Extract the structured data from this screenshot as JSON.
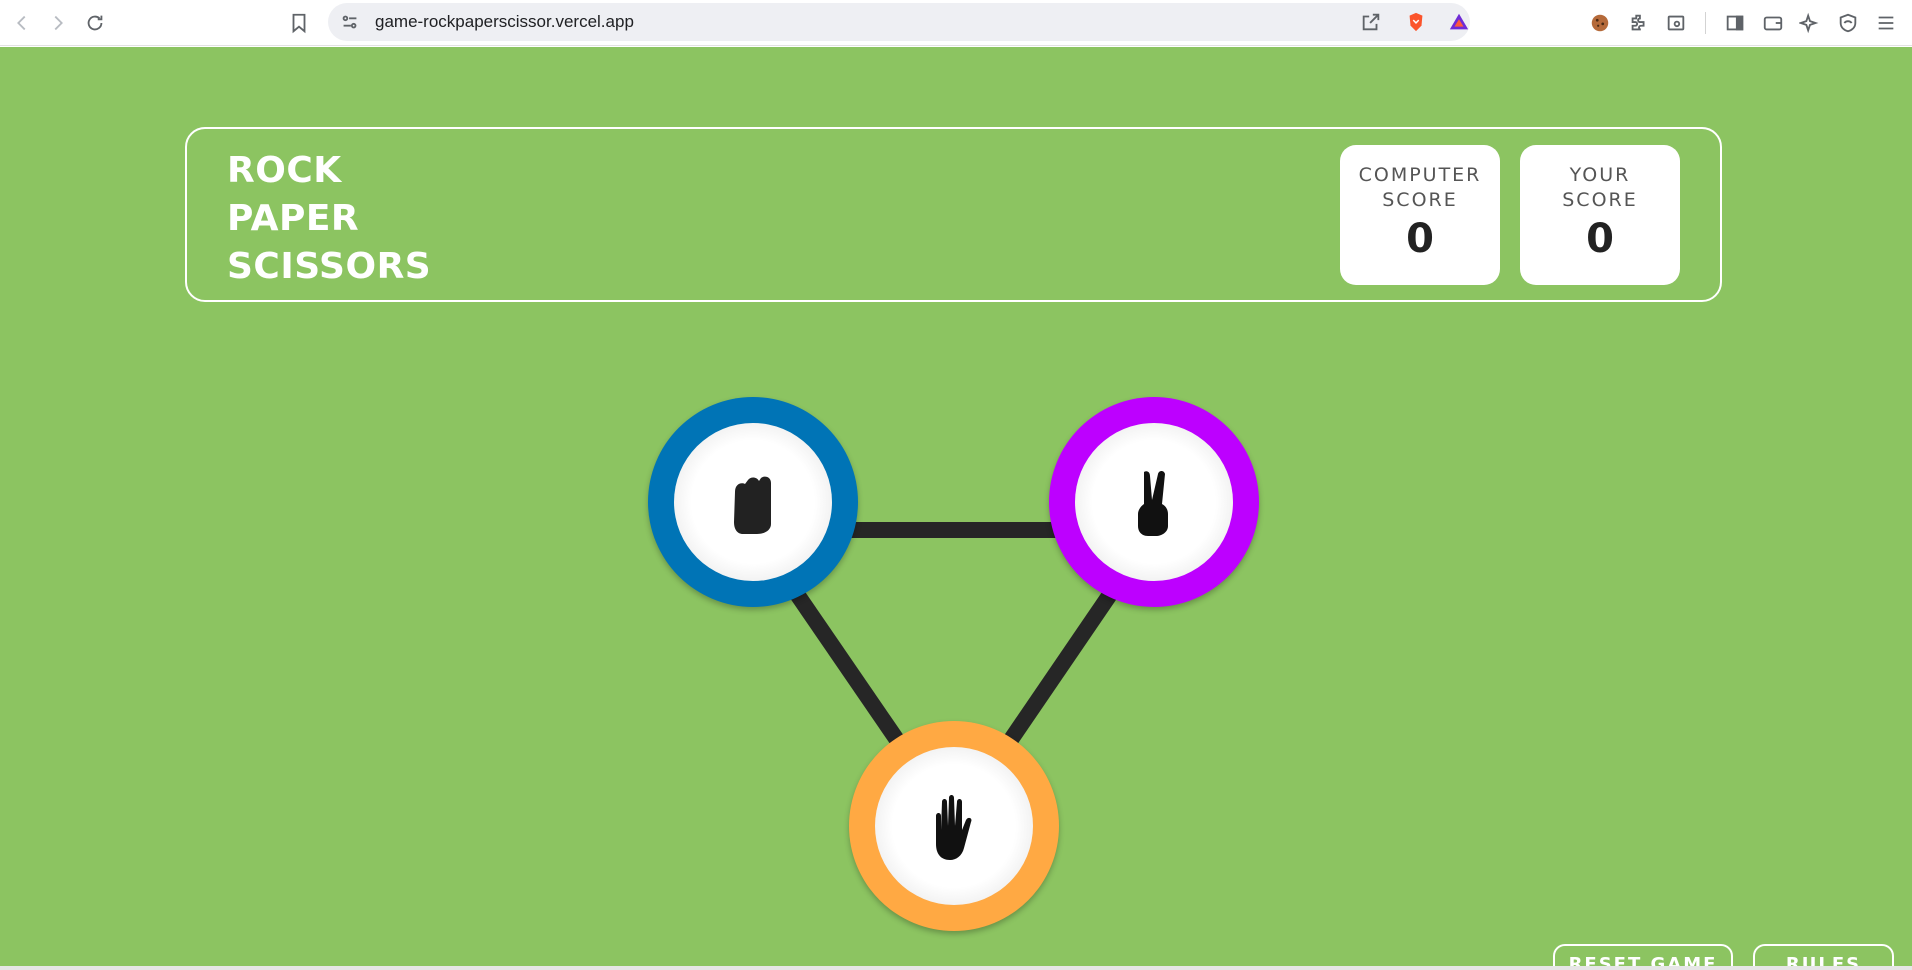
{
  "browser": {
    "url": "game-rockpaperscissor.vercel.app"
  },
  "game": {
    "title_lines": [
      "ROCK",
      "PAPER",
      "SCISSORS"
    ],
    "computer_score": {
      "label": "COMPUTER\nSCORE",
      "value": "0"
    },
    "your_score": {
      "label": "YOUR\nSCORE",
      "value": "0"
    },
    "choices": [
      {
        "name": "rock",
        "color": "#0074b6"
      },
      {
        "name": "scissors",
        "color": "#bd00ff"
      },
      {
        "name": "paper",
        "color": "#ffa943"
      }
    ],
    "reset_label": "RESET GAME",
    "rules_label": "RULES"
  },
  "colors": {
    "background": "#8cc461",
    "connector": "#262626"
  }
}
